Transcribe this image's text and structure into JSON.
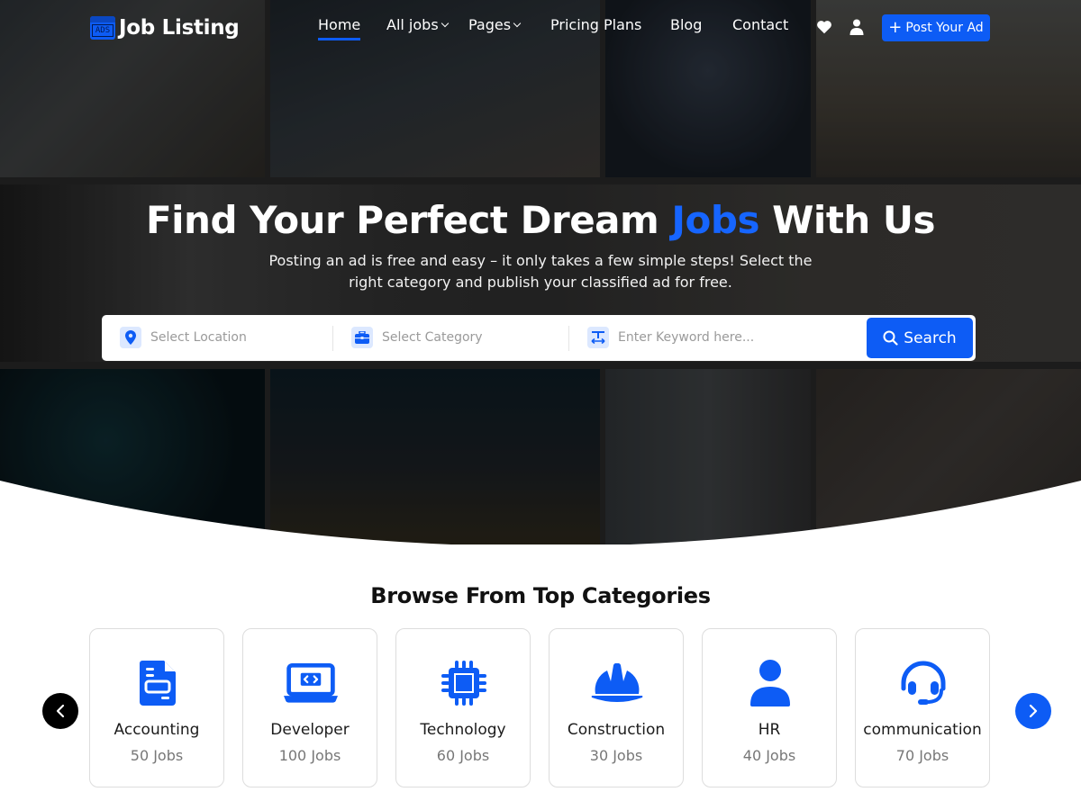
{
  "brand": {
    "logo_badge": "ADS",
    "name": "Job Listing",
    "accent_color": "#0d5cf5"
  },
  "nav": {
    "items": [
      {
        "label": "Home",
        "active": true,
        "dropdown": false
      },
      {
        "label": "All jobs",
        "active": false,
        "dropdown": true
      },
      {
        "label": "Pages",
        "active": false,
        "dropdown": true
      },
      {
        "label": "Pricing Plans",
        "active": false,
        "dropdown": false
      },
      {
        "label": "Blog",
        "active": false,
        "dropdown": false
      },
      {
        "label": "Contact",
        "active": false,
        "dropdown": false
      }
    ],
    "icons": [
      "heart-icon",
      "user-icon"
    ],
    "post_ad_label": "Post Your Ad",
    "post_ad_icon": "plus-icon"
  },
  "hero": {
    "headline_before": "Find Your Perfect Dream ",
    "headline_accent": "Jobs",
    "headline_after": " With Us",
    "subline": "Posting an ad is free and easy – it only takes a few simple steps! Select the right category and publish your classified ad for free."
  },
  "search": {
    "location": {
      "placeholder": "Select Location",
      "value": "",
      "icon": "map-pin-icon"
    },
    "category": {
      "placeholder": "Select Category",
      "value": "",
      "icon": "briefcase-icon"
    },
    "keyword": {
      "placeholder": "Enter Keyword here...",
      "value": "",
      "icon": "text-icon"
    },
    "button_label": "Search",
    "button_icon": "search-icon"
  },
  "categories": {
    "title": "Browse From Top Categories",
    "items": [
      {
        "name": "Accounting",
        "count": "50 Jobs",
        "icon": "document-icon"
      },
      {
        "name": "Developer",
        "count": "100 Jobs",
        "icon": "laptop-code-icon"
      },
      {
        "name": "Technology",
        "count": "60 Jobs",
        "icon": "chip-icon"
      },
      {
        "name": "Construction",
        "count": "30 Jobs",
        "icon": "hard-hat-icon"
      },
      {
        "name": "HR",
        "count": "40 Jobs",
        "icon": "person-icon"
      },
      {
        "name": "communication",
        "count": "70 Jobs",
        "icon": "headset-icon"
      }
    ],
    "prev_icon": "chevron-left-icon",
    "next_icon": "chevron-right-icon"
  }
}
